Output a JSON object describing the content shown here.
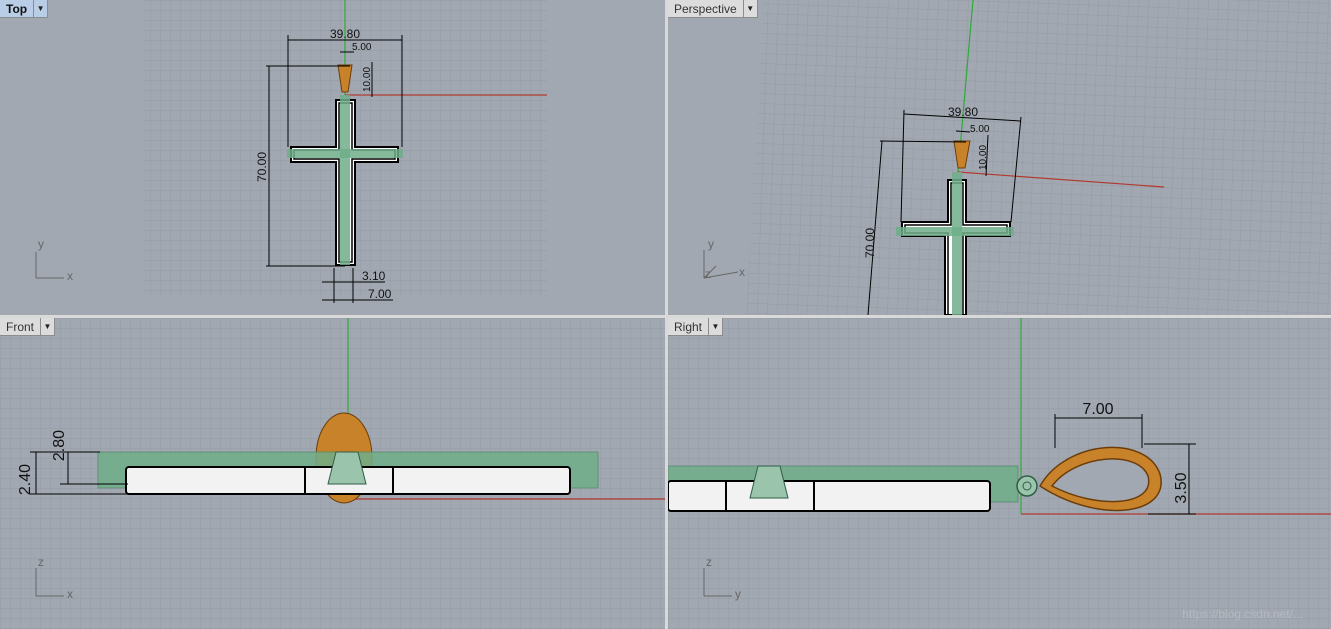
{
  "viewports": {
    "top": {
      "label": "Top",
      "axes": {
        "h": "x",
        "v": "y"
      }
    },
    "perspective": {
      "label": "Perspective",
      "axes": {
        "h": "x",
        "v": "y",
        "z": "z"
      }
    },
    "front": {
      "label": "Front",
      "axes": {
        "h": "x",
        "v": "z"
      }
    },
    "right": {
      "label": "Right",
      "axes": {
        "h": "y",
        "v": "z"
      }
    }
  },
  "dimensions": {
    "width": "39.80",
    "bail_width": "5.00",
    "bail_height": "10.00",
    "height": "70.00",
    "bar_width": "3.10",
    "bar_outer": "7.00",
    "front_thick_a": "2.40",
    "front_thick_b": "2.80",
    "right_loop_width": "7.00",
    "right_loop_height": "3.50"
  },
  "colors": {
    "viewport_bg": "#a2a8b2",
    "grid": "#8f959e",
    "axis_x": "#b03a2e",
    "axis_y": "#2eaa3a",
    "selection": "#6fae8a",
    "gold": "#c8832a"
  },
  "watermark": "https://blog.csdn.net/..."
}
